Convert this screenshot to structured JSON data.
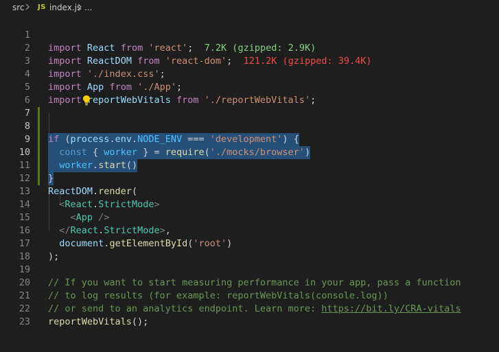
{
  "breadcrumb": {
    "folder": "src",
    "file_icon": "JS",
    "file": "index.js",
    "symbol": "..."
  },
  "import_hints": {
    "react": "7.2K (gzipped: 2.9K)",
    "react_dom": "121.2K (gzipped: 39.4K)"
  },
  "line_numbers": [
    "1",
    "2",
    "3",
    "4",
    "5",
    "6",
    "7",
    "8",
    "9",
    "10",
    "11",
    "12",
    "13",
    "14",
    "15",
    "16",
    "17",
    "18",
    "19",
    "20",
    "21",
    "22",
    "23"
  ],
  "code": {
    "l1": [
      "import",
      " ",
      "React",
      " ",
      "from",
      " ",
      "'react'",
      ";"
    ],
    "l2": [
      "import",
      " ",
      "ReactDOM",
      " ",
      "from",
      " ",
      "'react-dom'",
      ";"
    ],
    "l3": [
      "import",
      " ",
      "'./index.css'",
      ";"
    ],
    "l4": [
      "import",
      " ",
      "App",
      " ",
      "from",
      " ",
      "'./App'",
      ";"
    ],
    "l5": [
      "import",
      " ",
      "reportWebVitals",
      " ",
      "from",
      " ",
      "'./reportWebVitals'",
      ";"
    ],
    "l7": [
      "if",
      " (",
      "process",
      ".",
      "env",
      ".",
      "NODE_ENV",
      " === ",
      "'development'",
      ") {"
    ],
    "l8": [
      "const",
      " { ",
      "worker",
      " } = ",
      "require",
      "(",
      "'./mocks/browser'",
      ")"
    ],
    "l9": [
      "worker",
      ".",
      "start",
      "()"
    ],
    "l10": [
      "}"
    ],
    "l12": [
      "ReactDOM",
      ".",
      "render",
      "("
    ],
    "l13": [
      "<",
      "React",
      ".",
      "StrictMode",
      ">"
    ],
    "l14": [
      "<",
      "App",
      " />"
    ],
    "l15": [
      "</",
      "React",
      ".",
      "StrictMode",
      ">",
      ","
    ],
    "l16": [
      "document",
      ".",
      "getElementById",
      "(",
      "'root'",
      ")"
    ],
    "l17": [
      ");"
    ],
    "l19": "// If you want to start measuring performance in your app, pass a function",
    "l20": "// to log results (for example: reportWebVitals(console.log))",
    "l21_text": "// or send to an analytics endpoint. Learn more: ",
    "l21_link": "https://bit.ly/CRA-vitals",
    "l22": [
      "reportWebVitals",
      "();"
    ]
  },
  "colors": {
    "background": "#1e1e1e",
    "selection": "#264f78",
    "keyword": "#c586c0",
    "string": "#ce9178",
    "comment": "#6a9955",
    "modified_gutter": "#587c0c"
  },
  "icons": {
    "breadcrumb_separator": "chevron-right-icon",
    "lightbulb": "lightbulb-icon"
  }
}
